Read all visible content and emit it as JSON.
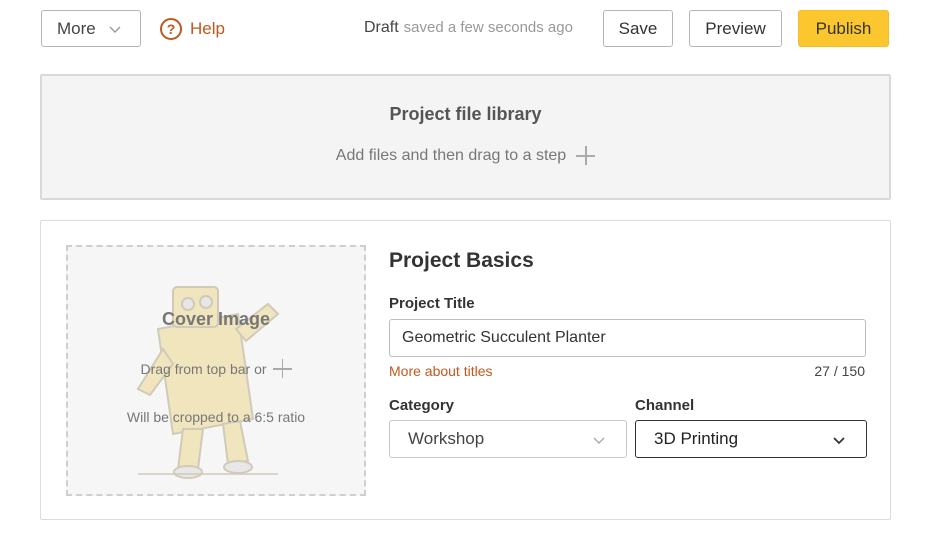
{
  "toolbar": {
    "more_label": "More",
    "help_label": "Help",
    "help_glyph": "?",
    "status_state": "Draft",
    "status_detail": "saved a few seconds ago",
    "save_label": "Save",
    "preview_label": "Preview",
    "publish_label": "Publish"
  },
  "library": {
    "title": "Project file library",
    "subtitle": "Add files and then drag to a step"
  },
  "cover": {
    "title": "Cover Image",
    "drag_text": "Drag from top bar or",
    "ratio_text": "Will be cropped to a 6:5 ratio"
  },
  "basics": {
    "heading": "Project Basics",
    "title_label": "Project Title",
    "title_value": "Geometric Succulent Planter",
    "more_titles_link": "More about titles",
    "char_count": "27 / 150",
    "category_label": "Category",
    "category_value": "Workshop",
    "channel_label": "Channel",
    "channel_value": "3D Printing"
  },
  "colors": {
    "accent_orange": "#c1581d",
    "publish_yellow": "#fcc62f",
    "library_bg": "#f4f4f4"
  },
  "icons": {
    "more_chevron": "chevron-down-icon",
    "help": "question-circle-icon",
    "add": "plus-icon",
    "cover_art": "robot-mascot-icon"
  }
}
